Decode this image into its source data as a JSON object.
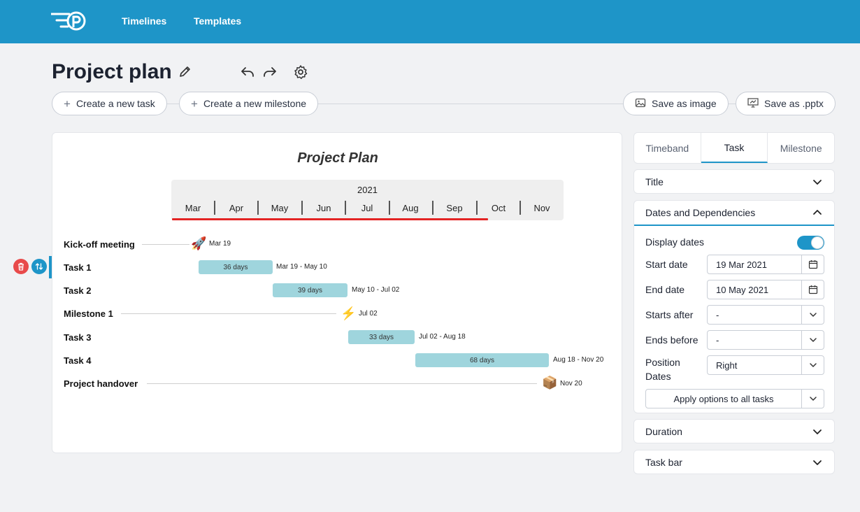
{
  "nav": {
    "timelines": "Timelines",
    "templates": "Templates"
  },
  "page": {
    "title": "Project plan"
  },
  "toolbar": {
    "new_task": "Create a new task",
    "new_milestone": "Create a new milestone",
    "save_image": "Save as image",
    "save_pptx": "Save as .pptx"
  },
  "chart": {
    "title": "Project Plan",
    "year": "2021",
    "months": [
      "Mar",
      "Apr",
      "May",
      "Jun",
      "Jul",
      "Aug",
      "Sep",
      "Oct",
      "Nov"
    ],
    "rows": [
      {
        "label": "Kick-off meeting",
        "kind": "milestone",
        "icon": "rocket-icon",
        "date_label": "Mar 19"
      },
      {
        "label": "Task 1",
        "kind": "task",
        "duration": "36 days",
        "date_label": "Mar 19 - May 10"
      },
      {
        "label": "Task 2",
        "kind": "task",
        "duration": "39 days",
        "date_label": "May 10 - Jul 02"
      },
      {
        "label": "Milestone 1",
        "kind": "milestone",
        "icon": "lightning-icon",
        "date_label": "Jul 02"
      },
      {
        "label": "Task 3",
        "kind": "task",
        "duration": "33 days",
        "date_label": "Jul 02 - Aug 18"
      },
      {
        "label": "Task 4",
        "kind": "task",
        "duration": "68 days",
        "date_label": "Aug 18 - Nov 20"
      },
      {
        "label": "Project handover",
        "kind": "milestone",
        "icon": "package-icon",
        "date_label": "Nov 20"
      }
    ],
    "colors": {
      "task_bar": "#9fd5dd",
      "today_line": "#e32424",
      "accent": "#1e95c8"
    }
  },
  "panel": {
    "tabs": [
      "Timeband",
      "Task",
      "Milestone"
    ],
    "active_tab": "Task",
    "sections": {
      "title": "Title",
      "dates": "Dates and Dependencies",
      "duration": "Duration",
      "task_bar": "Task bar"
    },
    "fields": {
      "display_dates": "Display dates",
      "start_date_label": "Start date",
      "start_date": "19 Mar 2021",
      "end_date_label": "End date",
      "end_date": "10 May 2021",
      "starts_after_label": "Starts after",
      "starts_after": "-",
      "ends_before_label": "Ends before",
      "ends_before": "-",
      "position_dates_label_1": "Position",
      "position_dates_label_2": "Dates",
      "position_dates": "Right",
      "apply": "Apply options to all tasks"
    }
  }
}
